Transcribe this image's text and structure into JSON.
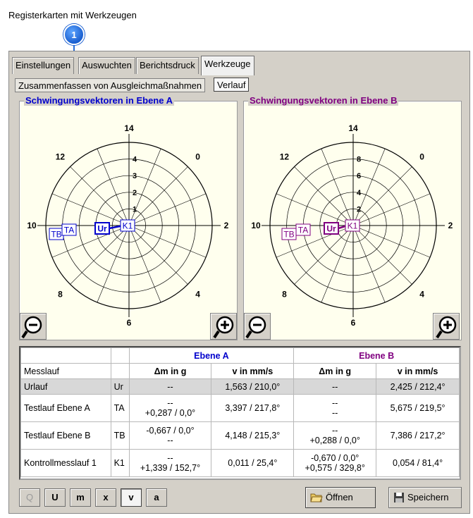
{
  "caption": "Registerkarten mit Werkzeugen",
  "marker": "1",
  "tabs": [
    "Einstellungen",
    "Auswuchten",
    "Berichtsdruck",
    "Werkzeuge"
  ],
  "subtabs": [
    "Zusammenfassen von Ausgleichmaßnahmen",
    "Verlauf"
  ],
  "panelA": {
    "title": "Schwingungsvektoren in Ebene A",
    "color": "#0000cc",
    "angles": [
      "14",
      "0",
      "2",
      "4",
      "6",
      "8",
      "10",
      "12"
    ],
    "radial": [
      "4",
      "3",
      "2",
      "1"
    ],
    "points": [
      "TB",
      "TA",
      "Ur",
      "K1"
    ]
  },
  "panelB": {
    "title": "Schwingungsvektoren in Ebene B",
    "color": "#800080",
    "angles": [
      "14",
      "0",
      "2",
      "4",
      "6",
      "8",
      "10",
      "12"
    ],
    "radial": [
      "8",
      "6",
      "4",
      "2"
    ],
    "points": [
      "TB",
      "TA",
      "Ur",
      "K1"
    ]
  },
  "table": {
    "group_a": "Ebene A",
    "group_b": "Ebene B",
    "col_run": "Messlauf",
    "col_dm": "Δm in g",
    "col_v": "v in mm/s",
    "rows": [
      {
        "name": "Urlauf",
        "code": "Ur",
        "a_dm1": "--",
        "a_dm2": "",
        "a_v": "1,563 / 210,0°",
        "b_dm1": "--",
        "b_dm2": "",
        "b_v": "2,425 / 212,4°"
      },
      {
        "name": "Testlauf Ebene A",
        "code": "TA",
        "a_dm1": "--",
        "a_dm2": "+0,287 / 0,0°",
        "a_v": "3,397 / 217,8°",
        "b_dm1": "--",
        "b_dm2": "--",
        "b_v": "5,675 / 219,5°"
      },
      {
        "name": "Testlauf Ebene B",
        "code": "TB",
        "a_dm1": "-0,667 / 0,0°",
        "a_dm2": "--",
        "a_v": "4,148 / 215,3°",
        "b_dm1": "--",
        "b_dm2": "+0,288 / 0,0°",
        "b_v": "7,386 / 217,2°"
      },
      {
        "name": "Kontrollmesslauf 1",
        "code": "K1",
        "a_dm1": "--",
        "a_dm2": "+1,339 / 152,7°",
        "a_v": "0,011 / 25,4°",
        "b_dm1": "-0,670 / 0,0°",
        "b_dm2": "+0,575 / 329,8°",
        "b_v": "0,054 / 81,4°"
      }
    ]
  },
  "toolbar": [
    "Q",
    "U",
    "m",
    "x",
    "v",
    "a"
  ],
  "open_label": "Öffnen",
  "save_label": "Speichern"
}
